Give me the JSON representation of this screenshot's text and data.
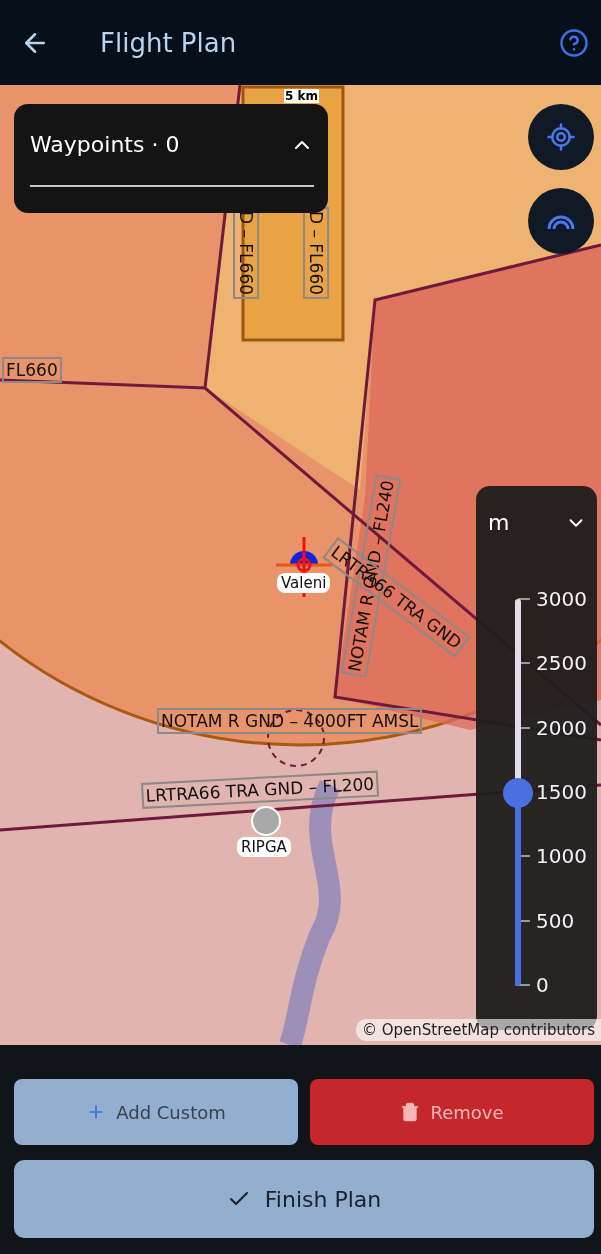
{
  "header": {
    "title": "Flight Plan"
  },
  "waypoints_panel": {
    "title": "Waypoints · 0",
    "expanded": true
  },
  "map": {
    "scale": "5 km",
    "attribution": "© OpenStreetMap contributors",
    "airspace_labels": [
      {
        "text": "FL660",
        "kind": "flat"
      },
      {
        "text": "D – FL660",
        "kind": "vertical"
      },
      {
        "text": "D – FL660",
        "kind": "vertical"
      },
      {
        "text": "NOTAM R GND – FL240",
        "kind": "vertical"
      },
      {
        "text": "LRTRA66 TRA GND",
        "kind": "slanted"
      },
      {
        "text": "NOTAM R GND – 4000FT AMSL",
        "kind": "flat"
      },
      {
        "text": "LRTRA66 TRA GND – FL200",
        "kind": "flat"
      }
    ],
    "points": [
      {
        "name": "Valeni",
        "kind": "position"
      },
      {
        "name": "RIPGA",
        "kind": "waypoint"
      }
    ]
  },
  "map_buttons": [
    {
      "kind": "locate"
    },
    {
      "kind": "layers"
    }
  ],
  "altitude_slider": {
    "unit": "m",
    "expanded": false,
    "ticks": [
      "3000",
      "2500",
      "2000",
      "1500",
      "1000",
      "500",
      "0"
    ],
    "level": 0.5
  },
  "actions": [
    {
      "label": "Add Custom",
      "kind": "add"
    },
    {
      "label": "Remove",
      "kind": "remove"
    }
  ],
  "finish_button": {
    "label": "Finish Plan"
  }
}
